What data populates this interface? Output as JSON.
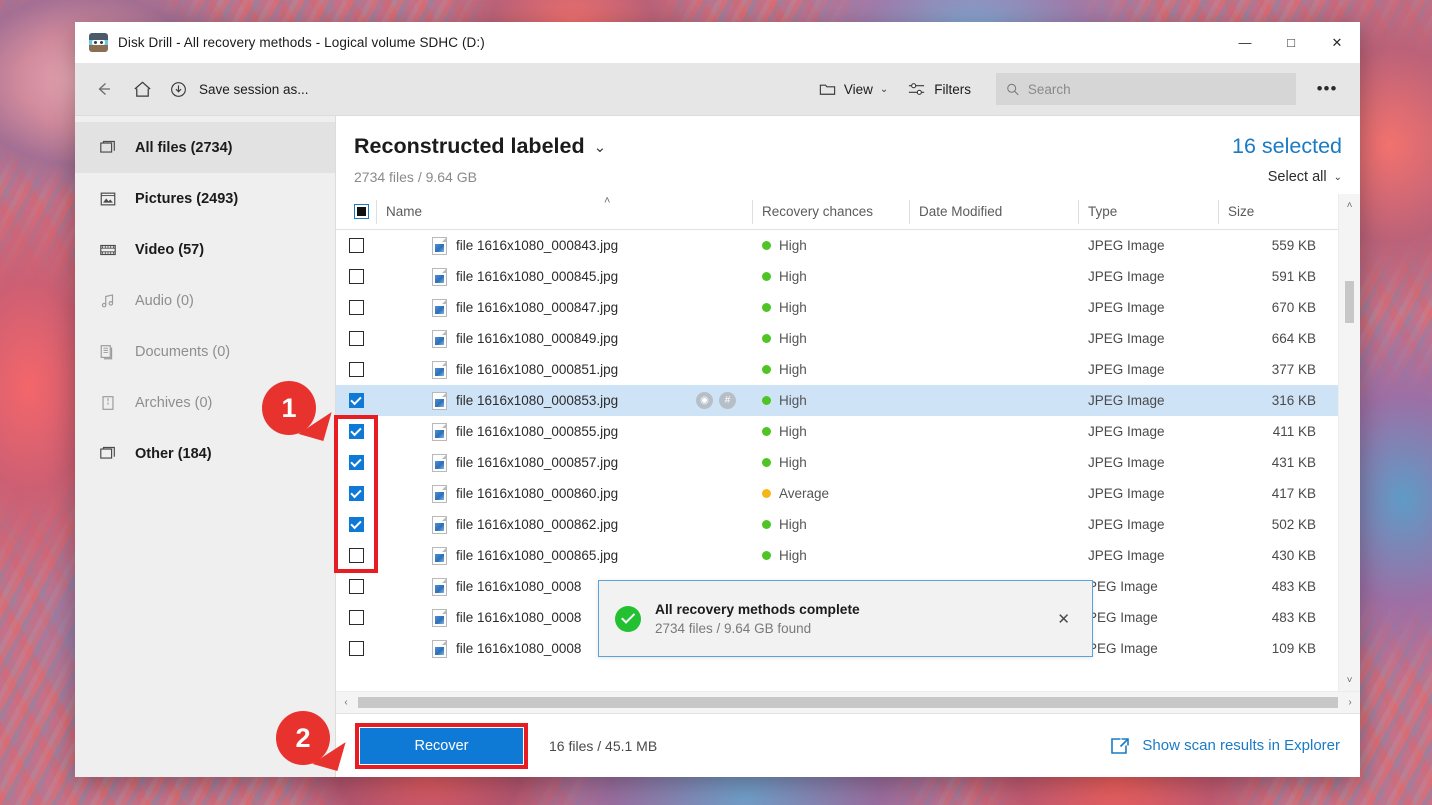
{
  "window": {
    "title": "Disk Drill - All recovery methods - Logical volume SDHC (D:)",
    "logo_icon": "disk-drill-logo-icon",
    "minimize_label": "—",
    "maximize_label": "□",
    "close_label": "✕"
  },
  "toolbar": {
    "back_icon": "arrow-left-icon",
    "home_icon": "home-icon",
    "save_icon": "download-circle-icon",
    "save_session_label": "Save session as...",
    "view_label": "View",
    "view_icon": "folder-icon",
    "filters_label": "Filters",
    "filters_icon": "sliders-icon",
    "search_placeholder": "Search",
    "search_value": "",
    "search_icon": "search-icon",
    "overflow_label": "•••",
    "chevron": "⌄"
  },
  "sidebar": {
    "items": [
      {
        "label": "All files (2734)",
        "icon": "files-icon",
        "active": true,
        "dim": false
      },
      {
        "label": "Pictures (2493)",
        "icon": "picture-icon",
        "active": false,
        "dim": false
      },
      {
        "label": "Video (57)",
        "icon": "film-icon",
        "active": false,
        "dim": false
      },
      {
        "label": "Audio (0)",
        "icon": "music-note-icon",
        "active": false,
        "dim": true
      },
      {
        "label": "Documents (0)",
        "icon": "documents-icon",
        "active": false,
        "dim": true
      },
      {
        "label": "Archives (0)",
        "icon": "archive-icon",
        "active": false,
        "dim": true
      },
      {
        "label": "Other (184)",
        "icon": "files-icon",
        "active": false,
        "dim": false
      }
    ]
  },
  "main": {
    "title": "Reconstructed labeled",
    "title_chevron": "⌄",
    "subtitle": "2734 files / 9.64 GB",
    "selected_count": "16 selected",
    "select_all_label": "Select all",
    "select_all_chevron": "⌄",
    "sort_caret": "˄"
  },
  "table": {
    "header_checkbox_state": "indeterminate",
    "columns": [
      "Name",
      "Recovery chances",
      "Date Modified",
      "Type",
      "Size"
    ],
    "rows": [
      {
        "checked": false,
        "name": "file 1616x1080_000843.jpg",
        "chance": "High",
        "chance_color": "#4ec425",
        "date": "",
        "type": "JPEG Image",
        "size": "559 KB",
        "selected": false,
        "hover": false
      },
      {
        "checked": false,
        "name": "file 1616x1080_000845.jpg",
        "chance": "High",
        "chance_color": "#4ec425",
        "date": "",
        "type": "JPEG Image",
        "size": "591 KB",
        "selected": false,
        "hover": false
      },
      {
        "checked": false,
        "name": "file 1616x1080_000847.jpg",
        "chance": "High",
        "chance_color": "#4ec425",
        "date": "",
        "type": "JPEG Image",
        "size": "670 KB",
        "selected": false,
        "hover": false
      },
      {
        "checked": false,
        "name": "file 1616x1080_000849.jpg",
        "chance": "High",
        "chance_color": "#4ec425",
        "date": "",
        "type": "JPEG Image",
        "size": "664 KB",
        "selected": false,
        "hover": false
      },
      {
        "checked": false,
        "name": "file 1616x1080_000851.jpg",
        "chance": "High",
        "chance_color": "#4ec425",
        "date": "",
        "type": "JPEG Image",
        "size": "377 KB",
        "selected": false,
        "hover": false
      },
      {
        "checked": true,
        "name": "file 1616x1080_000853.jpg",
        "chance": "High",
        "chance_color": "#4ec425",
        "date": "",
        "type": "JPEG Image",
        "size": "316 KB",
        "selected": true,
        "hover": true
      },
      {
        "checked": true,
        "name": "file 1616x1080_000855.jpg",
        "chance": "High",
        "chance_color": "#4ec425",
        "date": "",
        "type": "JPEG Image",
        "size": "411 KB",
        "selected": false,
        "hover": false
      },
      {
        "checked": true,
        "name": "file 1616x1080_000857.jpg",
        "chance": "High",
        "chance_color": "#4ec425",
        "date": "",
        "type": "JPEG Image",
        "size": "431 KB",
        "selected": false,
        "hover": false
      },
      {
        "checked": true,
        "name": "file 1616x1080_000860.jpg",
        "chance": "Average",
        "chance_color": "#f5b718",
        "date": "",
        "type": "JPEG Image",
        "size": "417 KB",
        "selected": false,
        "hover": false
      },
      {
        "checked": true,
        "name": "file 1616x1080_000862.jpg",
        "chance": "High",
        "chance_color": "#4ec425",
        "date": "",
        "type": "JPEG Image",
        "size": "502 KB",
        "selected": false,
        "hover": false
      },
      {
        "checked": false,
        "name": "file 1616x1080_000865.jpg",
        "chance": "High",
        "chance_color": "#4ec425",
        "date": "",
        "type": "JPEG Image",
        "size": "430 KB",
        "selected": false,
        "hover": false
      },
      {
        "checked": false,
        "name": "file 1616x1080_0008",
        "chance": "",
        "chance_color": "#4ec425",
        "date": "",
        "type": "PEG Image",
        "size": "483 KB",
        "selected": false,
        "hover": false
      },
      {
        "checked": false,
        "name": "file 1616x1080_0008",
        "chance": "",
        "chance_color": "#4ec425",
        "date": "",
        "type": "PEG Image",
        "size": "483 KB",
        "selected": false,
        "hover": false
      },
      {
        "checked": false,
        "name": "file 1616x1080_0008",
        "chance": "",
        "chance_color": "#f5b718",
        "date": "",
        "type": "PEG Image",
        "size": "109 KB",
        "selected": false,
        "hover": false
      }
    ],
    "hover_actions": [
      "preview-eye-icon",
      "hex-view-icon"
    ],
    "scroll_up_icon": "˄",
    "scroll_down_icon": "˅",
    "scroll_left_icon": "‹",
    "scroll_right_icon": "›"
  },
  "toast": {
    "icon": "success-check-icon",
    "title": "All recovery methods complete",
    "subtitle": "2734 files / 9.64 GB found",
    "close_label": "✕"
  },
  "footer": {
    "recover_label": "Recover",
    "stat": "16 files / 45.1 MB",
    "explorer_label": "Show scan results in Explorer",
    "explorer_icon": "open-in-explorer-icon"
  },
  "annotations": {
    "callout_1": "1",
    "callout_2": "2",
    "highlight_color": "#e81c23"
  }
}
